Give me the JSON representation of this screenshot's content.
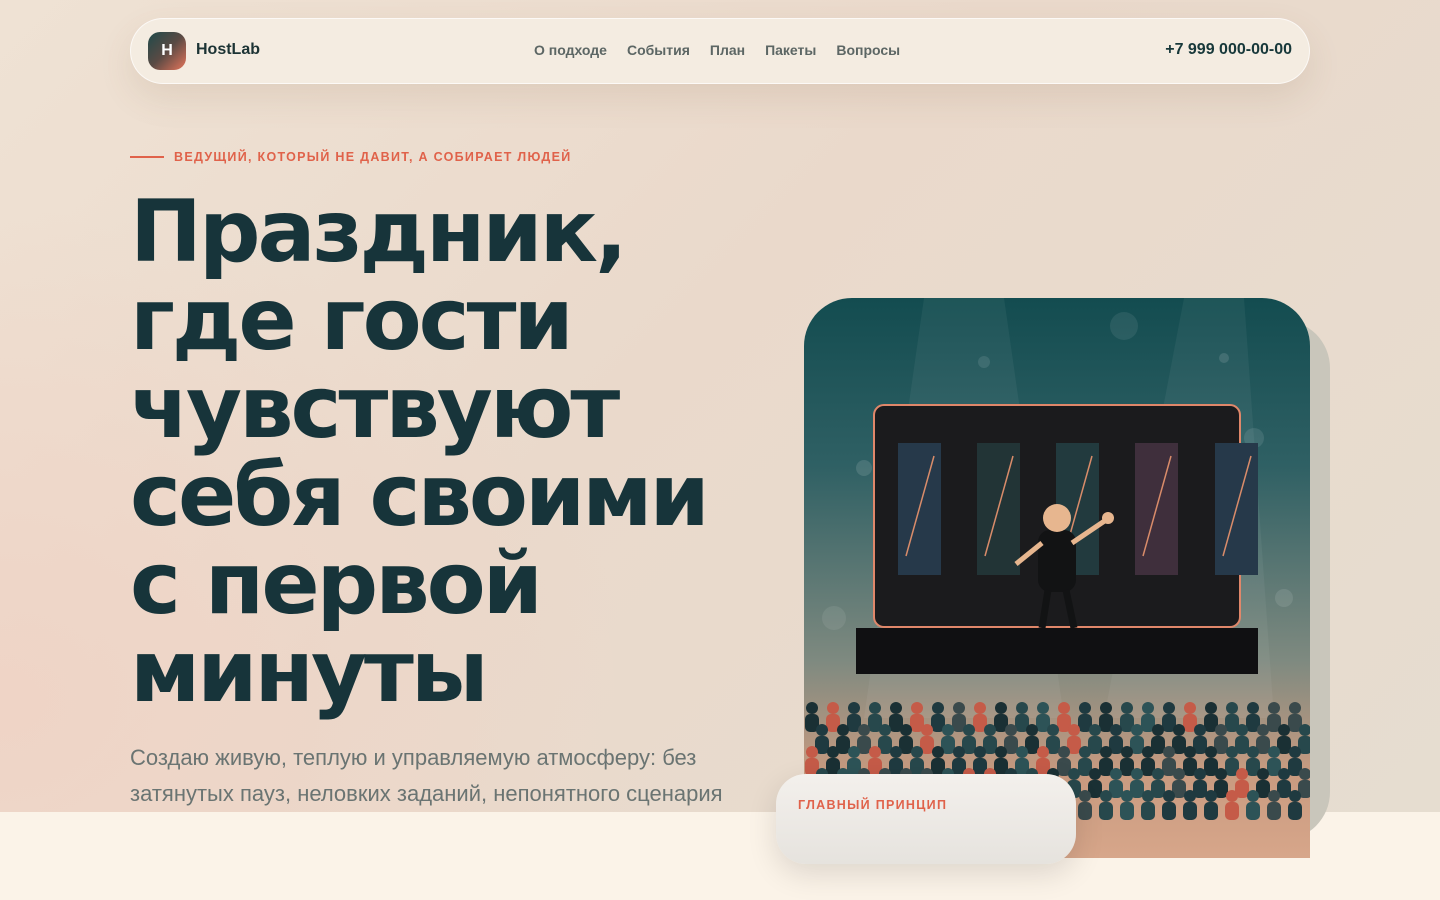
{
  "nav": {
    "logo_letter": "H",
    "brand": "HostLab",
    "links": [
      "О подходе",
      "События",
      "План",
      "Пакеты",
      "Вопросы"
    ],
    "phone": "+7 999 000-00-00"
  },
  "hero": {
    "eyebrow": "ВЕДУЩИЙ, КОТОРЫЙ НЕ ДАВИТ, А СОБИРАЕТ ЛЮДЕЙ",
    "headline": "Праздник, где гости чувствуют себя своими с первой минуты",
    "lead": "Создаю живую, теплую и управляемую атмосферу: без затянутых пауз, неловких заданий, непонятного сценария",
    "principle_label": "ГЛАВНЫЙ ПРИНЦИП"
  },
  "colors": {
    "accent": "#e0624a",
    "ink": "#17343a",
    "muted": "#6a7472"
  }
}
